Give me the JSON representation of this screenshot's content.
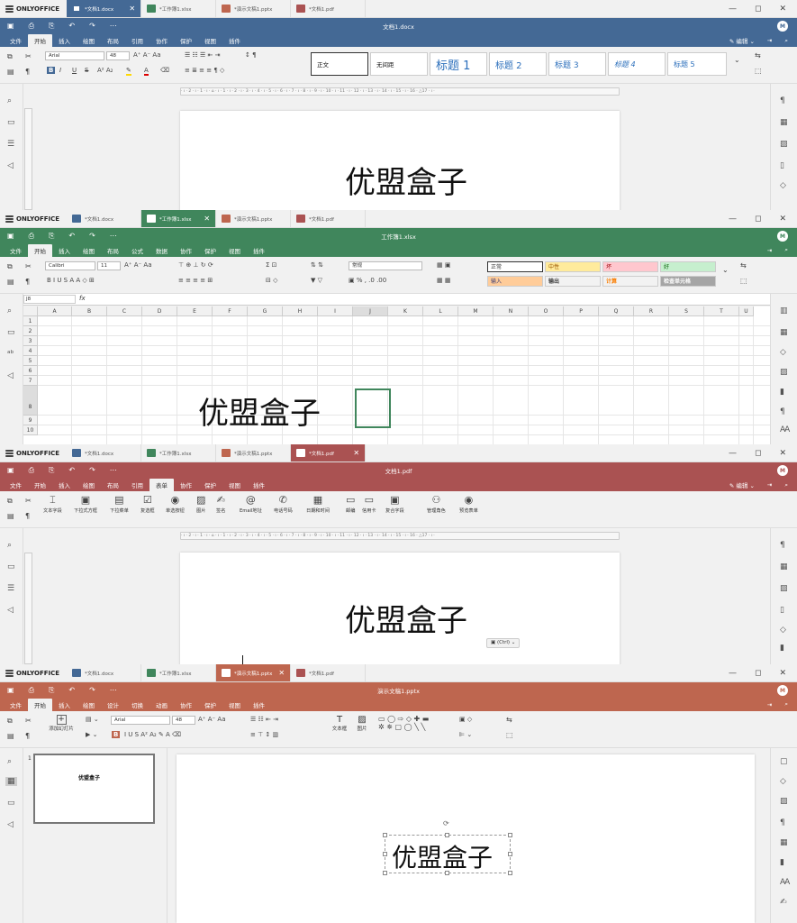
{
  "colors": {
    "word": "#446995",
    "cell": "#40865c",
    "pdf": "#aa5252",
    "slide": "#be664f"
  },
  "brand": "ONLYOFFICE",
  "tabs": [
    "*文档1.docx",
    "*工作簿1.xlsx",
    "*演示文稿1.pptx",
    "*文档1.pdf"
  ],
  "window_controls": [
    "—",
    "◻",
    "✕"
  ],
  "doc": {
    "title": "文档1.docx",
    "menus": [
      "文件",
      "开始",
      "插入",
      "绘图",
      "布局",
      "引用",
      "协作",
      "保护",
      "视图",
      "插件"
    ],
    "edit_label": "编辑",
    "font": "Arial",
    "size": "48",
    "styles": [
      "正文",
      "无间距",
      "标题 1",
      "标题 2",
      "标题 3",
      "标题 4",
      "标题 5"
    ],
    "content": "优盟盒子"
  },
  "cell": {
    "title": "工作簿1.xlsx",
    "menus": [
      "文件",
      "开始",
      "插入",
      "绘图",
      "布局",
      "公式",
      "数据",
      "协作",
      "保护",
      "视图",
      "插件"
    ],
    "font": "Calibri",
    "size": "11",
    "format": "常规",
    "cell_styles": [
      "正常",
      "中性",
      "坏",
      "好",
      "输入",
      "输出",
      "计算",
      "检查单元格"
    ],
    "namebox": "J8",
    "fx": "fx",
    "columns": [
      "A",
      "B",
      "C",
      "D",
      "E",
      "F",
      "G",
      "H",
      "I",
      "J",
      "K",
      "L",
      "M",
      "N",
      "O",
      "P",
      "Q",
      "R",
      "S",
      "T",
      "U"
    ],
    "rows": [
      "1",
      "2",
      "3",
      "4",
      "5",
      "6",
      "7",
      "8",
      "9",
      "10"
    ],
    "content": "优盟盒子"
  },
  "pdf": {
    "title": "文档1.pdf",
    "menus": [
      "文件",
      "开始",
      "插入",
      "绘图",
      "布局",
      "引用",
      "表单",
      "协作",
      "保护",
      "视图",
      "插件"
    ],
    "edit_label": "编辑",
    "form_tools": [
      "文本字段",
      "下拉式方框",
      "下拉菜单",
      "复选框",
      "单选按钮",
      "图片",
      "签名",
      "Email地址",
      "电话号码",
      "日期和时间",
      "邮编",
      "信用卡",
      "复合字段",
      "管理角色",
      "预览表单"
    ],
    "paste_hint": "(Ctrl)",
    "content": "优盟盒子"
  },
  "slide": {
    "title": "演示文稿1.pptx",
    "menus": [
      "文件",
      "开始",
      "插入",
      "绘图",
      "设计",
      "切换",
      "动画",
      "协作",
      "保护",
      "视图",
      "插件"
    ],
    "add_slide": "添加幻灯片",
    "font": "Arial",
    "size": "48",
    "textbox": "文本框",
    "image": "图片",
    "slide_number": "1",
    "thumb_text": "优盟盒子",
    "content": "优盟盒子"
  }
}
